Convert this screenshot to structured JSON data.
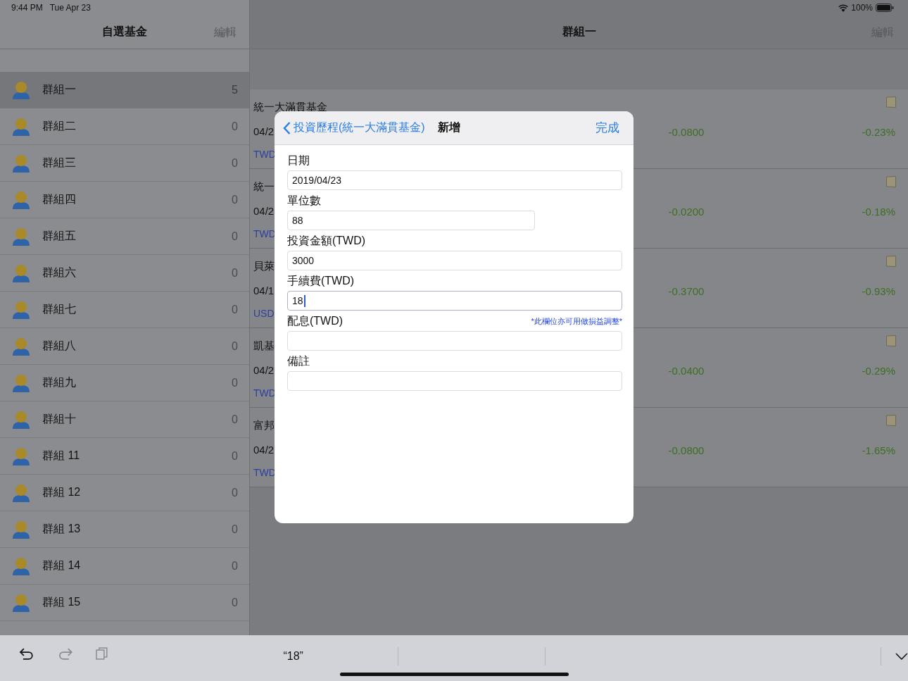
{
  "status_bar": {
    "time": "9:44 PM",
    "date": "Tue Apr 23",
    "battery": "100%"
  },
  "sidebar": {
    "title": "自選基金",
    "edit": "編輯",
    "items": [
      {
        "name": "群組一",
        "count": "5",
        "selected": true
      },
      {
        "name": "群組二",
        "count": "0",
        "selected": false
      },
      {
        "name": "群組三",
        "count": "0",
        "selected": false
      },
      {
        "name": "群組四",
        "count": "0",
        "selected": false
      },
      {
        "name": "群組五",
        "count": "0",
        "selected": false
      },
      {
        "name": "群組六",
        "count": "0",
        "selected": false
      },
      {
        "name": "群組七",
        "count": "0",
        "selected": false
      },
      {
        "name": "群組八",
        "count": "0",
        "selected": false
      },
      {
        "name": "群組九",
        "count": "0",
        "selected": false
      },
      {
        "name": "群組十",
        "count": "0",
        "selected": false
      },
      {
        "name": "群組 11",
        "count": "0",
        "selected": false
      },
      {
        "name": "群組 12",
        "count": "0",
        "selected": false
      },
      {
        "name": "群組 13",
        "count": "0",
        "selected": false
      },
      {
        "name": "群組 14",
        "count": "0",
        "selected": false
      },
      {
        "name": "群組 15",
        "count": "0",
        "selected": false
      }
    ]
  },
  "main": {
    "title": "群組一",
    "edit": "編輯",
    "funds": [
      {
        "name": "統一大滿貫基金",
        "date": "04/2",
        "currency": "TWD",
        "change": "-0.0800",
        "percent": "-0.23%"
      },
      {
        "name": "統一",
        "date": "04/2",
        "currency": "TWD",
        "change": "-0.0200",
        "percent": "-0.18%"
      },
      {
        "name": "貝萊",
        "date": "04/1",
        "currency": "USD",
        "change": "-0.3700",
        "percent": "-0.93%"
      },
      {
        "name": "凱基",
        "date": "04/2",
        "currency": "TWD",
        "change": "-0.0400",
        "percent": "-0.29%"
      },
      {
        "name": "富邦",
        "date": "04/2",
        "currency": "TWD",
        "change": "-0.0800",
        "percent": "-1.65%"
      }
    ]
  },
  "dialog": {
    "back": "投資歷程(統一大滿貫基金)",
    "title": "新增",
    "done": "完成",
    "fields": [
      {
        "label": "日期",
        "value": "2019/04/23",
        "kind": "wide",
        "focused": false
      },
      {
        "label": "單位數",
        "value": "88",
        "kind": "narrow",
        "focused": false
      },
      {
        "label": "投資金額(TWD)",
        "value": "3000",
        "kind": "wide",
        "focused": false
      },
      {
        "label": "手續費(TWD)",
        "value": "18",
        "kind": "wide",
        "focused": true
      },
      {
        "label": "配息(TWD)",
        "note": "*此欄位亦可用做損益調整*",
        "kind": "wide",
        "focused": false
      },
      {
        "label": "備註",
        "kind": "wide",
        "focused": false
      }
    ]
  },
  "keyboard_bar": {
    "suggestion": "“18”"
  }
}
